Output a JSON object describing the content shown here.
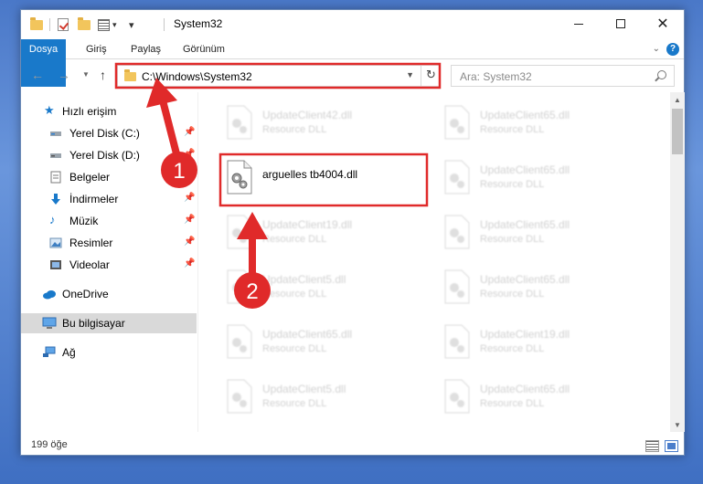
{
  "window": {
    "title": "System32",
    "status_count": "199 öğe"
  },
  "ribbon": {
    "tabs": [
      "Dosya",
      "Giriş",
      "Paylaş",
      "Görünüm"
    ]
  },
  "navigation": {
    "address": "C:\\Windows\\System32",
    "search_placeholder": "Ara: System32"
  },
  "sidebar": {
    "items": [
      {
        "label": "Hızlı erişim",
        "icon": "star-icon",
        "pinned": false
      },
      {
        "label": "Yerel Disk (C:)",
        "icon": "drive-icon",
        "pinned": true
      },
      {
        "label": "Yerel Disk (D:)",
        "icon": "drive-icon",
        "pinned": true
      },
      {
        "label": "Belgeler",
        "icon": "documents-icon",
        "pinned": true
      },
      {
        "label": "İndirmeler",
        "icon": "downloads-icon",
        "pinned": true
      },
      {
        "label": "Müzik",
        "icon": "music-icon",
        "pinned": true
      },
      {
        "label": "Resimler",
        "icon": "pictures-icon",
        "pinned": true
      },
      {
        "label": "Videolar",
        "icon": "videos-icon",
        "pinned": true
      },
      {
        "label": "OneDrive",
        "icon": "onedrive-icon",
        "pinned": false
      },
      {
        "label": "Bu bilgisayar",
        "icon": "computer-icon",
        "pinned": false,
        "selected": true
      },
      {
        "label": "Ağ",
        "icon": "network-icon",
        "pinned": false
      }
    ]
  },
  "files": {
    "main": {
      "name": "arguelles tb4004.dll"
    },
    "left_column": [
      {
        "name": "UpdateClient42.dll",
        "type": "Resource DLL"
      },
      {
        "name": "UpdateClient19.dll",
        "type": "Resource DLL"
      },
      {
        "name": "UpdateClient5.dll",
        "type": "Resource DLL"
      },
      {
        "name": "UpdateClient65.dll",
        "type": "Resource DLL"
      },
      {
        "name": "UpdateClient5.dll",
        "type": "Resource DLL"
      }
    ],
    "right_column": [
      {
        "name": "UpdateClient65.dll",
        "type": "Resource DLL"
      },
      {
        "name": "UpdateClient65.dll",
        "type": "Resource DLL"
      },
      {
        "name": "UpdateClient65.dll",
        "type": "Resource DLL"
      },
      {
        "name": "UpdateClient65.dll",
        "type": "Resource DLL"
      },
      {
        "name": "UpdateClient19.dll",
        "type": "Resource DLL"
      },
      {
        "name": "UpdateClient65.dll",
        "type": "Resource DLL"
      }
    ]
  },
  "annotations": {
    "badges": [
      "1",
      "2"
    ],
    "color": "#e02a2a"
  }
}
